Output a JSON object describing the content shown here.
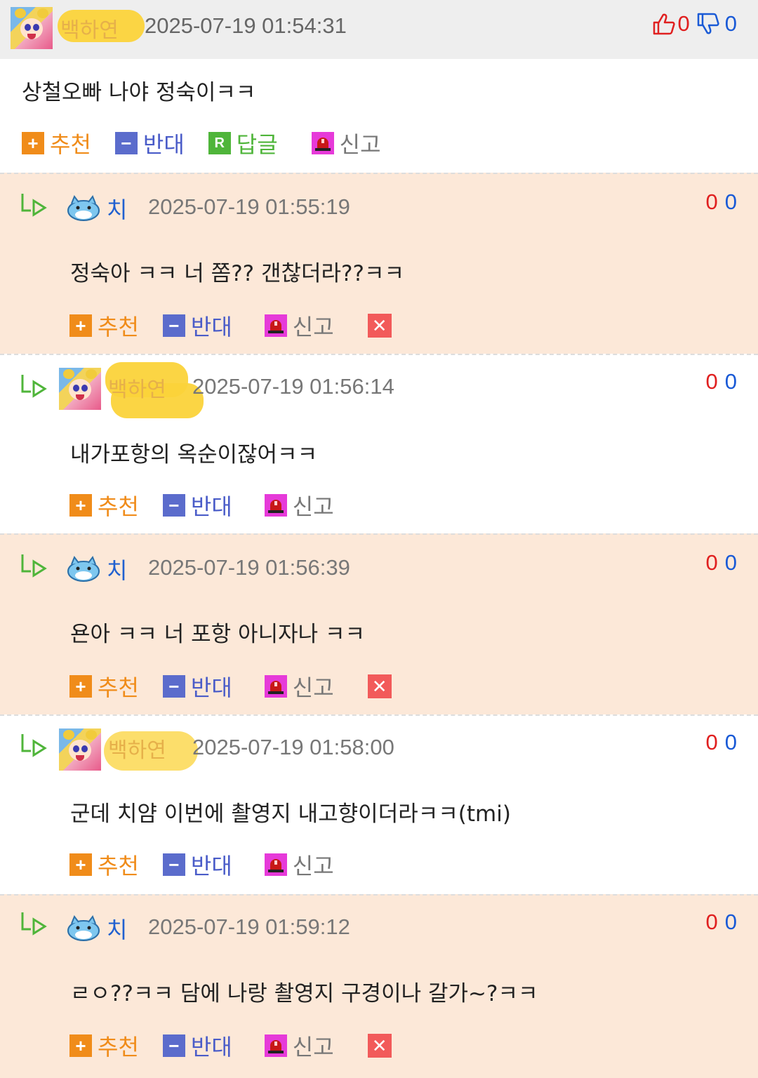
{
  "parent": {
    "nickname": "백하연",
    "timestamp": "2025-07-19 01:54:31",
    "likes": "0",
    "dislikes": "0",
    "text": "상철오빠 나야 정숙이ㅋㅋ",
    "actions": {
      "recommend": "추천",
      "oppose": "반대",
      "reply": "답글",
      "report": "신고"
    }
  },
  "replies": [
    {
      "nickname": "치",
      "timestamp": "2025-07-19 01:55:19",
      "likes": "0",
      "dislikes": "0",
      "text": "정숙아 ㅋㅋ 너 쫌?? 갠찮더라??ㅋㅋ",
      "recommend": "추천",
      "oppose": "반대",
      "report": "신고"
    },
    {
      "nickname": "백하연",
      "timestamp": "2025-07-19 01:56:14",
      "likes": "0",
      "dislikes": "0",
      "text": "내가포항의 옥순이잖어ㅋㅋ",
      "recommend": "추천",
      "oppose": "반대",
      "report": "신고"
    },
    {
      "nickname": "치",
      "timestamp": "2025-07-19 01:56:39",
      "likes": "0",
      "dislikes": "0",
      "text": "욘아 ㅋㅋ 너 포항 아니자나 ㅋㅋ",
      "recommend": "추천",
      "oppose": "반대",
      "report": "신고"
    },
    {
      "nickname": "백하연",
      "timestamp": "2025-07-19 01:58:00",
      "likes": "0",
      "dislikes": "0",
      "text": "군데 치얌 이번에 촬영지 내고향이더라ㅋㅋ(tmi)",
      "recommend": "추천",
      "oppose": "반대",
      "report": "신고"
    },
    {
      "nickname": "치",
      "timestamp": "2025-07-19 01:59:12",
      "likes": "0",
      "dislikes": "0",
      "text": "ㄹㅇ??ㅋㅋ 담에 나랑 촬영지 구경이나 갈가~?ㅋㅋ",
      "recommend": "추천",
      "oppose": "반대",
      "report": "신고"
    }
  ],
  "colors": {
    "recommend": "#f08c1a",
    "oppose": "#4a5cc8",
    "reply": "#4fb53a",
    "report_icon": "#e63ad9",
    "tint": "#fce8d8",
    "like": "#e02020",
    "dislike": "#1a5ad6"
  },
  "icons": [
    "thumbs-up-icon",
    "thumbs-down-icon",
    "plus-icon",
    "minus-icon",
    "reply-icon",
    "siren-icon",
    "delete-icon",
    "reply-arrow-icon",
    "catbus-avatar-icon",
    "sailor-avatar"
  ]
}
